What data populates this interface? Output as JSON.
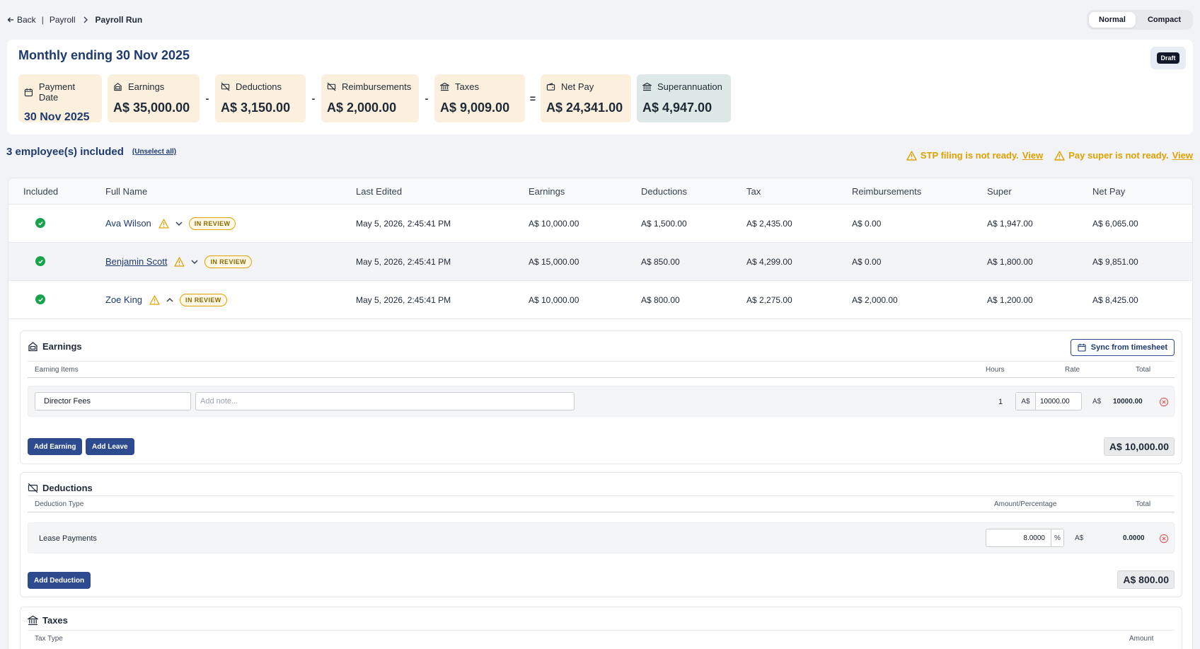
{
  "breadcrumb": {
    "back": "Back",
    "separator": "|",
    "section": "Payroll",
    "current": "Payroll Run"
  },
  "density": {
    "options": [
      "Normal",
      "Compact"
    ],
    "selected": "Normal"
  },
  "summary": {
    "title": "Monthly ending 30 Nov 2025",
    "status": "Draft",
    "tiles": [
      {
        "label": "Payment Date",
        "value": "30 Nov 2025",
        "icon": "calendar-icon"
      },
      {
        "label": "Earnings",
        "value": "A$ 35,000.00",
        "icon": "money-bag-icon"
      },
      {
        "label": "Deductions",
        "value": "A$ 3,150.00",
        "icon": "money-off-icon"
      },
      {
        "label": "Reimbursements",
        "value": "A$ 2,000.00",
        "icon": "money-off-icon"
      },
      {
        "label": "Taxes",
        "value": "A$ 9,009.00",
        "icon": "bank-icon"
      },
      {
        "label": "Net Pay",
        "value": "A$ 24,341.00",
        "icon": "wallet-icon"
      },
      {
        "label": "Superannuation",
        "value": "A$ 4,947.00",
        "icon": "bank-icon"
      }
    ],
    "operators": [
      "-",
      "-",
      "-",
      "="
    ]
  },
  "employees": {
    "count_label": "3 employee(s) included",
    "unselect_label": "(Unselect all)"
  },
  "warnings": [
    {
      "text": "STP filing is not ready.",
      "link": "View"
    },
    {
      "text": "Pay super is not ready.",
      "link": "View"
    }
  ],
  "table": {
    "headers": [
      "Included",
      "Full Name",
      "Last Edited",
      "Earnings",
      "Deductions",
      "Tax",
      "Reimbursements",
      "Super",
      "Net Pay"
    ],
    "rows": [
      {
        "name": "Ava Wilson",
        "status": "IN REVIEW",
        "edited": "May 5, 2026, 2:45:41 PM",
        "earnings": "A$ 10,000.00",
        "deductions": "A$ 1,500.00",
        "tax": "A$ 2,435.00",
        "reimbursements": "A$ 0.00",
        "super": "A$ 1,947.00",
        "net": "A$ 6,065.00",
        "expanded": false
      },
      {
        "name": "Benjamin Scott",
        "status": "IN REVIEW",
        "edited": "May 5, 2026, 2:45:41 PM",
        "earnings": "A$ 15,000.00",
        "deductions": "A$ 850.00",
        "tax": "A$ 4,299.00",
        "reimbursements": "A$ 0.00",
        "super": "A$ 1,800.00",
        "net": "A$ 9,851.00",
        "expanded": false
      },
      {
        "name": "Zoe King",
        "status": "IN REVIEW",
        "edited": "May 5, 2026, 2:45:41 PM",
        "earnings": "A$ 10,000.00",
        "deductions": "A$ 800.00",
        "tax": "A$ 2,275.00",
        "reimbursements": "A$ 2,000.00",
        "super": "A$ 1,200.00",
        "net": "A$ 8,425.00",
        "expanded": true
      }
    ]
  },
  "earnings_section": {
    "title": "Earnings",
    "sync_label": "Sync from timesheet",
    "col_items": "Earning Items",
    "col_hours": "Hours",
    "col_rate": "Rate",
    "col_total": "Total",
    "item": {
      "name": "Director Fees",
      "note_placeholder": "Add note...",
      "hours": "1",
      "currency": "A$",
      "rate": "10000.00",
      "total_currency": "A$",
      "total": "10000.00"
    },
    "add_earning": "Add Earning",
    "add_leave": "Add Leave",
    "section_total": "A$ 10,000.00"
  },
  "deductions_section": {
    "title": "Deductions",
    "col_type": "Deduction Type",
    "col_amount": "Amount/Percentage",
    "col_total": "Total",
    "item": {
      "name": "Lease Payments",
      "amount": "8.0000",
      "unit": "%",
      "currency": "A$",
      "total": "0.0000"
    },
    "add_deduction": "Add Deduction",
    "section_total": "A$ 800.00"
  },
  "taxes_section": {
    "title": "Taxes",
    "col_type": "Tax Type",
    "col_amount": "Amount"
  },
  "colors": {
    "brand": "#1e3a6e",
    "primary_button": "#2e4b8f",
    "warning": "#e0a100",
    "success": "#16a34a",
    "tile_bg": "#fbf0dd",
    "super_tile_bg": "#dde8e7"
  }
}
